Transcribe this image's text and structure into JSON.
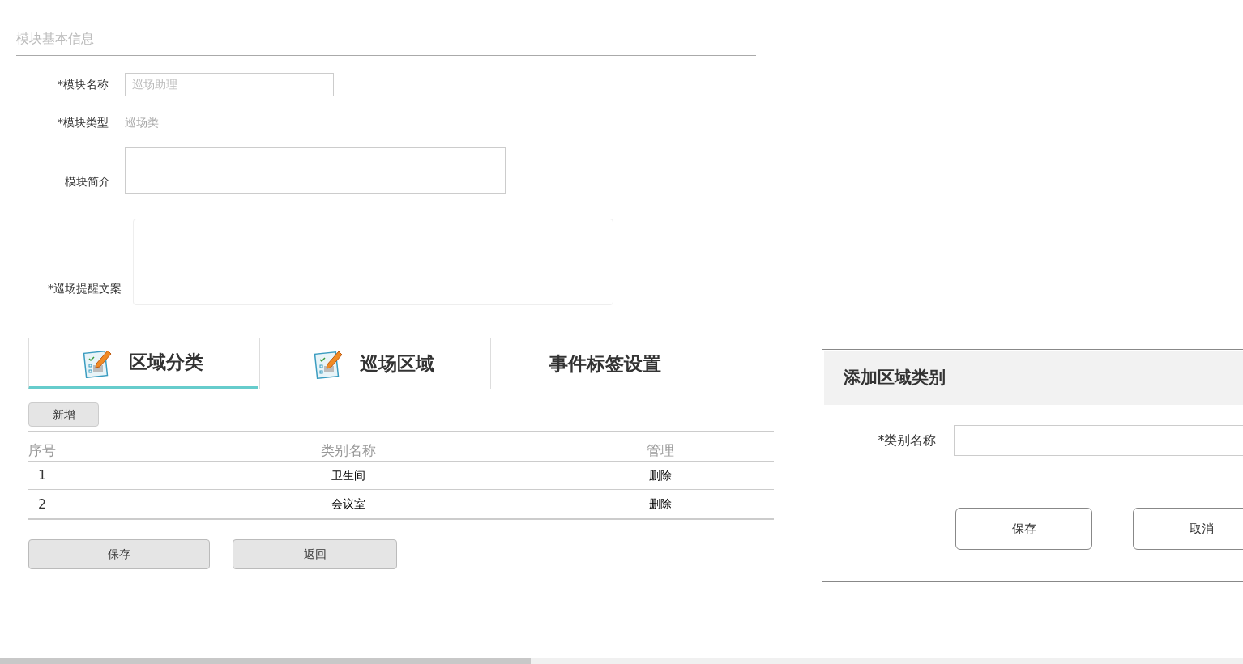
{
  "section_title": "模块基本信息",
  "form": {
    "name_label": "*模块名称",
    "name_placeholder": "巡场助理",
    "type_label": "*模块类型",
    "type_value": "巡场类",
    "intro_label": "模块简介",
    "reminder_label": "*巡场提醒文案"
  },
  "tabs": [
    {
      "label": "区域分类",
      "icon": true,
      "selected": true
    },
    {
      "label": "巡场区域",
      "icon": true,
      "selected": false
    },
    {
      "label": "事件标签设置",
      "icon": false,
      "selected": false
    }
  ],
  "add_button": "新增",
  "table": {
    "columns": [
      "序号",
      "类别名称",
      "管理"
    ],
    "rows": [
      {
        "index": "1",
        "name": "卫生间",
        "action": "删除"
      },
      {
        "index": "2",
        "name": "会议室",
        "action": "删除"
      }
    ]
  },
  "buttons": [
    "保存",
    "返回"
  ],
  "dialog": {
    "title": "添加区域类别",
    "field_label": "*类别名称",
    "buttons": [
      "保存",
      "取消"
    ]
  }
}
